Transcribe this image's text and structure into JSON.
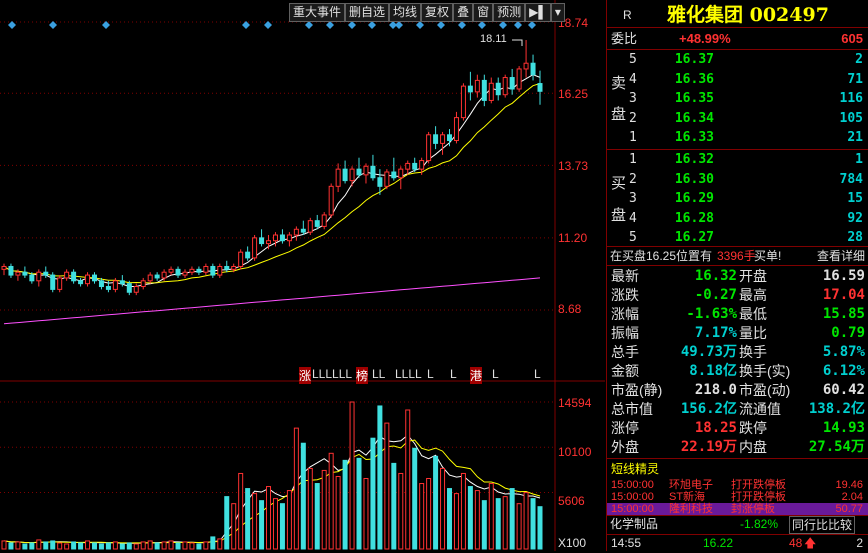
{
  "toolbar": {
    "items": [
      "重大事件",
      "删自选",
      "均线",
      "复权",
      "叠",
      "窗",
      "预测"
    ],
    "nav_icon": "next-page-icon",
    "dropdown_icon": "chevron-down-icon"
  },
  "axis": {
    "price_ticks": [
      "18.74",
      "16.25",
      "13.73",
      "11.20",
      "8.68"
    ],
    "volume_ticks": [
      "14594",
      "10100",
      "5606"
    ],
    "volume_unit": "X100",
    "high_label": "18.11"
  },
  "signal_marks": [
    "涨",
    "LLLLLL",
    "榜",
    "LL",
    "LLLL",
    "L",
    "L",
    "港",
    "L",
    "L"
  ],
  "header": {
    "marker": "R",
    "title": "雅化集团 002497"
  },
  "weibi": {
    "label": "委比",
    "value": "+48.99%",
    "diff": "605"
  },
  "sell": {
    "label": [
      "卖",
      "盘"
    ],
    "levels": [
      {
        "n": "5",
        "price": "16.37",
        "vol": "2"
      },
      {
        "n": "4",
        "price": "16.36",
        "vol": "71"
      },
      {
        "n": "3",
        "price": "16.35",
        "vol": "116"
      },
      {
        "n": "2",
        "price": "16.34",
        "vol": "105"
      },
      {
        "n": "1",
        "price": "16.33",
        "vol": "21"
      }
    ]
  },
  "buy": {
    "label": [
      "买",
      "盘"
    ],
    "levels": [
      {
        "n": "1",
        "price": "16.32",
        "vol": "1"
      },
      {
        "n": "2",
        "price": "16.30",
        "vol": "784"
      },
      {
        "n": "3",
        "price": "16.29",
        "vol": "15"
      },
      {
        "n": "4",
        "price": "16.28",
        "vol": "92"
      },
      {
        "n": "5",
        "price": "16.27",
        "vol": "28"
      }
    ]
  },
  "buy_notice": {
    "text1": "在买盘16.25位置有",
    "vol": "3396手",
    "text2": "买单!",
    "link": "查看详细"
  },
  "stats": [
    {
      "l1": "最新",
      "v1": "16.32",
      "c1": "green",
      "l2": "开盘",
      "v2": "16.59",
      "c2": "white"
    },
    {
      "l1": "涨跌",
      "v1": "-0.27",
      "c1": "green",
      "l2": "最高",
      "v2": "17.04",
      "c2": "red"
    },
    {
      "l1": "涨幅",
      "v1": "-1.63%",
      "c1": "green",
      "l2": "最低",
      "v2": "15.85",
      "c2": "green"
    },
    {
      "l1": "振幅",
      "v1": "7.17%",
      "c1": "cyan",
      "l2": "量比",
      "v2": "0.79",
      "c2": "green"
    },
    {
      "l1": "总手",
      "v1": "49.73万",
      "c1": "cyan",
      "l2": "换手",
      "v2": "5.87%",
      "c2": "cyan"
    },
    {
      "l1": "金额",
      "v1": "8.18亿",
      "c1": "cyan",
      "l2": "换手(实)",
      "v2": "6.12%",
      "c2": "cyan"
    },
    {
      "l1": "市盈(静)",
      "v1": "218.0",
      "c1": "white",
      "l2": "市盈(动)",
      "v2": "60.42",
      "c2": "white"
    },
    {
      "l1": "总市值",
      "v1": "156.2亿",
      "c1": "cyan",
      "l2": "流通值",
      "v2": "138.2亿",
      "c2": "cyan"
    },
    {
      "l1": "涨停",
      "v1": "18.25",
      "c1": "red",
      "l2": "跌停",
      "v2": "14.93",
      "c2": "green"
    },
    {
      "l1": "外盘",
      "v1": "22.19万",
      "c1": "red",
      "l2": "内盘",
      "v2": "27.54万",
      "c2": "green"
    }
  ],
  "short_line": {
    "title": "短线精灵",
    "items": [
      {
        "time": "15:00:00",
        "name": "环旭电子",
        "event": "打开跌停板",
        "value": "19.46"
      },
      {
        "time": "15:00:00",
        "name": "ST新海",
        "event": "打开跌停板",
        "value": "2.04"
      },
      {
        "time": "15:00:00",
        "name": "隆利科技",
        "event": "封涨停板",
        "value": "50.77"
      }
    ]
  },
  "sector": {
    "name": "化学制品",
    "change": "-1.82%",
    "compare": "同行比比较"
  },
  "bottom": {
    "time": "14:55",
    "price": "16.22",
    "vol": "48",
    "arrow": "up-arrow-icon",
    "count": "2"
  },
  "colors": {
    "up": "#ff3232",
    "down": "#00e600",
    "ma5": "#ffffff",
    "ma10": "#ffff00",
    "ma60": "#ff50ff",
    "grid": "#800000"
  },
  "chart_data": {
    "type": "candlestick",
    "ylim": [
      8.68,
      18.74
    ],
    "yticks": [
      18.74,
      16.25,
      13.73,
      11.2,
      8.68
    ],
    "volume_ylim": [
      0,
      14594
    ],
    "volume_ticks": [
      14594,
      10100,
      5606
    ],
    "series_ohlc": [
      [
        10.1,
        10.3,
        9.9,
        10.2
      ],
      [
        10.2,
        10.3,
        9.8,
        9.9
      ],
      [
        9.9,
        10.1,
        9.7,
        10.0
      ],
      [
        10.0,
        10.2,
        9.8,
        9.9
      ],
      [
        9.9,
        10.0,
        9.6,
        9.7
      ],
      [
        9.7,
        10.1,
        9.5,
        10.0
      ],
      [
        10.0,
        10.2,
        9.8,
        9.9
      ],
      [
        9.9,
        10.0,
        9.3,
        9.4
      ],
      [
        9.4,
        9.9,
        9.3,
        9.8
      ],
      [
        9.8,
        10.1,
        9.7,
        10.0
      ],
      [
        10.0,
        10.1,
        9.6,
        9.7
      ],
      [
        9.7,
        9.8,
        9.5,
        9.6
      ],
      [
        9.6,
        10.0,
        9.5,
        9.9
      ],
      [
        9.9,
        10.0,
        9.6,
        9.7
      ],
      [
        9.7,
        9.8,
        9.4,
        9.5
      ],
      [
        9.5,
        9.7,
        9.3,
        9.4
      ],
      [
        9.4,
        9.8,
        9.3,
        9.7
      ],
      [
        9.7,
        9.9,
        9.5,
        9.6
      ],
      [
        9.6,
        9.7,
        9.2,
        9.3
      ],
      [
        9.3,
        9.6,
        9.2,
        9.5
      ],
      [
        9.5,
        9.8,
        9.4,
        9.7
      ],
      [
        9.7,
        10.0,
        9.6,
        9.9
      ],
      [
        9.9,
        10.0,
        9.7,
        9.8
      ],
      [
        9.8,
        10.1,
        9.7,
        10.0
      ],
      [
        10.0,
        10.2,
        9.9,
        10.1
      ],
      [
        10.1,
        10.2,
        9.8,
        9.9
      ],
      [
        9.9,
        10.1,
        9.8,
        10.0
      ],
      [
        10.0,
        10.2,
        9.9,
        10.1
      ],
      [
        10.1,
        10.2,
        9.9,
        10.0
      ],
      [
        10.0,
        10.3,
        9.9,
        10.2
      ],
      [
        10.2,
        10.3,
        9.8,
        9.9
      ],
      [
        9.9,
        10.3,
        9.8,
        10.2
      ],
      [
        10.2,
        10.4,
        10.0,
        10.1
      ],
      [
        10.1,
        10.3,
        10.0,
        10.2
      ],
      [
        10.2,
        10.8,
        10.1,
        10.7
      ],
      [
        10.7,
        10.9,
        10.4,
        10.5
      ],
      [
        10.5,
        11.3,
        10.4,
        11.2
      ],
      [
        11.2,
        11.5,
        10.9,
        11.0
      ],
      [
        11.0,
        11.3,
        10.8,
        11.1
      ],
      [
        11.1,
        11.4,
        10.9,
        11.3
      ],
      [
        11.3,
        11.5,
        11.0,
        11.1
      ],
      [
        11.1,
        11.4,
        10.9,
        11.3
      ],
      [
        11.3,
        11.6,
        11.1,
        11.5
      ],
      [
        11.5,
        11.8,
        11.3,
        11.4
      ],
      [
        11.4,
        11.9,
        11.3,
        11.8
      ],
      [
        11.8,
        12.0,
        11.5,
        11.6
      ],
      [
        11.6,
        12.1,
        11.5,
        12.0
      ],
      [
        12.0,
        13.1,
        11.9,
        13.0
      ],
      [
        13.0,
        13.8,
        12.8,
        13.6
      ],
      [
        13.6,
        13.9,
        13.1,
        13.2
      ],
      [
        13.2,
        13.7,
        13.0,
        13.6
      ],
      [
        13.6,
        14.0,
        13.3,
        13.4
      ],
      [
        13.4,
        13.8,
        13.1,
        13.7
      ],
      [
        13.7,
        14.1,
        13.2,
        13.3
      ],
      [
        13.3,
        13.6,
        12.7,
        13.0
      ],
      [
        13.0,
        13.6,
        12.9,
        13.5
      ],
      [
        13.5,
        14.0,
        13.2,
        13.3
      ],
      [
        13.3,
        13.7,
        12.9,
        13.6
      ],
      [
        13.6,
        13.9,
        13.4,
        13.8
      ],
      [
        13.8,
        14.0,
        13.5,
        13.6
      ],
      [
        13.6,
        14.0,
        13.4,
        13.9
      ],
      [
        13.9,
        14.9,
        13.8,
        14.8
      ],
      [
        14.8,
        15.1,
        14.3,
        14.5
      ],
      [
        14.5,
        14.9,
        14.1,
        14.8
      ],
      [
        14.8,
        15.0,
        14.4,
        14.6
      ],
      [
        14.6,
        15.6,
        14.5,
        15.4
      ],
      [
        15.4,
        16.6,
        15.3,
        16.5
      ],
      [
        16.5,
        17.0,
        16.0,
        16.3
      ],
      [
        16.3,
        16.9,
        16.1,
        16.7
      ],
      [
        16.7,
        16.9,
        15.8,
        16.0
      ],
      [
        16.0,
        16.8,
        15.9,
        16.6
      ],
      [
        16.6,
        16.8,
        16.0,
        16.2
      ],
      [
        16.2,
        16.9,
        16.1,
        16.8
      ],
      [
        16.8,
        17.1,
        16.2,
        16.4
      ],
      [
        16.4,
        17.2,
        16.3,
        17.1
      ],
      [
        17.1,
        18.11,
        16.8,
        17.3
      ],
      [
        17.3,
        17.6,
        16.7,
        16.9
      ],
      [
        16.59,
        17.04,
        15.85,
        16.32
      ]
    ],
    "volumes": [
      800,
      600,
      700,
      500,
      600,
      900,
      700,
      800,
      600,
      500,
      700,
      600,
      800,
      600,
      500,
      600,
      700,
      500,
      600,
      500,
      700,
      800,
      600,
      700,
      800,
      600,
      700,
      600,
      500,
      700,
      1200,
      1000,
      5200,
      4500,
      7500,
      6000,
      5500,
      4800,
      6200,
      5000,
      4500,
      5800,
      12000,
      10500,
      8000,
      6500,
      7800,
      9500,
      7200,
      8800,
      14594,
      9000,
      7000,
      11000,
      14200,
      12500,
      8500,
      7500,
      13800,
      10000,
      6500,
      7000,
      9200,
      8000,
      6000,
      5500,
      7500,
      6200,
      5800,
      4800,
      6500,
      5000,
      5200,
      6000,
      4500,
      5600,
      5000,
      4200
    ]
  }
}
